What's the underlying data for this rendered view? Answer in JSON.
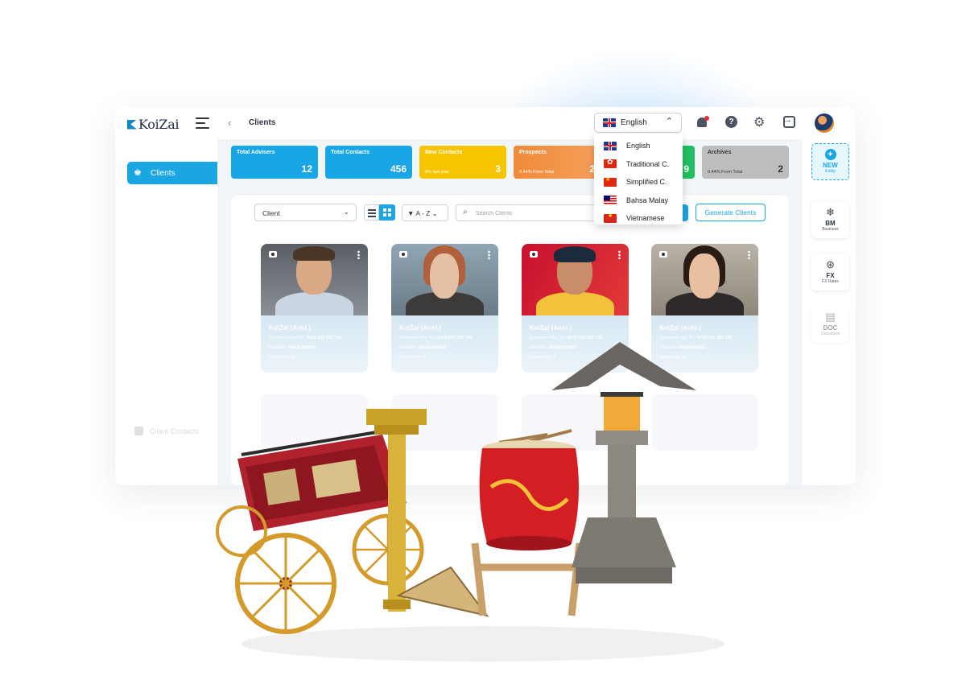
{
  "brand": {
    "name": "KoiZai"
  },
  "header": {
    "breadcrumb": "Clients",
    "language_selected": "English"
  },
  "sidebar": {
    "items": [
      {
        "label": "Clients",
        "icon": "users-icon"
      }
    ],
    "faded_label": "Client Contacts"
  },
  "stats": [
    {
      "title": "Total Advisers",
      "sub": "",
      "value": "12",
      "color": "#18a6e6"
    },
    {
      "title": "Total Contacts",
      "sub": "",
      "value": "456",
      "color": "#18a6e6"
    },
    {
      "title": "New Contacts",
      "sub": "0% last year",
      "value": "3",
      "color": "#f7c400"
    },
    {
      "title": "Prospects",
      "sub": "0.44% From Total",
      "value": "2",
      "color": "#ef8a3c"
    },
    {
      "title": "",
      "sub": "",
      "value": "9",
      "color": "#22c063"
    },
    {
      "title": "Archives",
      "sub": "0.44% From Total",
      "value": "2",
      "color": "#bdbdbd"
    }
  ],
  "toolbar": {
    "client_select": "Client",
    "sort_label": "A - Z",
    "search_placeholder": "Search Clients",
    "generate_label": "Generate Clients"
  },
  "clients": [
    {
      "name": "KoiZai (Aust.)",
      "reg_label": "Company Reg No:",
      "reg": "ACN 636 383 792",
      "id_label": "Identifier:",
      "identifier": "MAIAUS0061",
      "dealership": "Dealership: A"
    },
    {
      "name": "KoiZai (Aust.)",
      "reg_label": "Company Reg No:",
      "reg": "ACN 636 383 792",
      "id_label": "Identifier:",
      "identifier": "MAIAUS0061",
      "dealership": "Dealership: A"
    },
    {
      "name": "KoiZai (Aust.)",
      "reg_label": "Company Reg No:",
      "reg": "ACN 636 383 792",
      "id_label": "Identifier:",
      "identifier": "MAIAUS0061",
      "dealership": "Dealership: A"
    },
    {
      "name": "KoiZai (Aust.)",
      "reg_label": "Company Reg No:",
      "reg": "ACN 636 383 792",
      "id_label": "Identifier:",
      "identifier": "MAIAUS0061",
      "dealership": "Dealership: A"
    }
  ],
  "languages": [
    {
      "label": "English",
      "flag": "uk"
    },
    {
      "label": "Traditional C.",
      "flag": "hk"
    },
    {
      "label": "Simplified C.",
      "flag": "cn"
    },
    {
      "label": "Bahsa Malay",
      "flag": "my"
    },
    {
      "label": "Vietnamese",
      "flag": "vn"
    }
  ],
  "rail": [
    {
      "title": "NEW",
      "sub": "Entity",
      "icon": "plus-icon"
    },
    {
      "title": "BM",
      "sub": "Business",
      "icon": "network-icon"
    },
    {
      "title": "FX",
      "sub": "FX Rates",
      "icon": "currency-icon"
    },
    {
      "title": "DOC",
      "sub": "Document",
      "icon": "document-icon"
    }
  ],
  "colors": {
    "accent": "#1aa6e3",
    "text": "#2b3442"
  }
}
